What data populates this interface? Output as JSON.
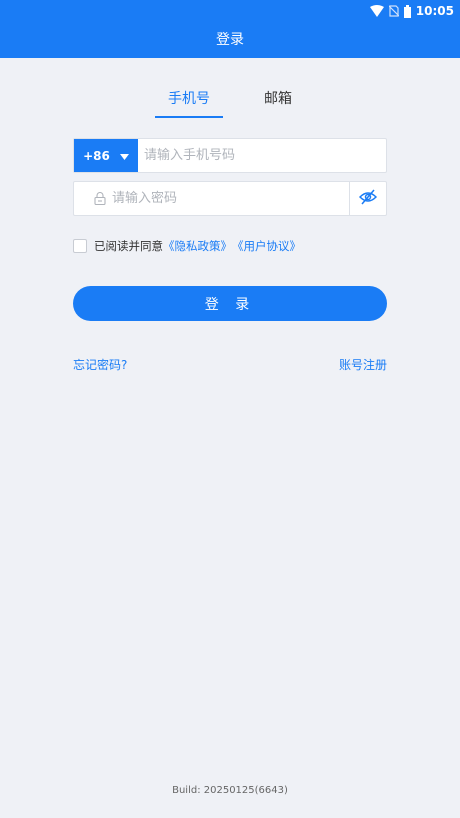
{
  "status_bar": {
    "time": "10:05",
    "icons": [
      "wifi-icon",
      "no-sim-icon",
      "battery-icon"
    ]
  },
  "header": {
    "title": "登录"
  },
  "tabs": [
    {
      "label": "手机号",
      "active": true
    },
    {
      "label": "邮箱",
      "active": false
    }
  ],
  "phone": {
    "country_code": "+86",
    "placeholder": "请输入手机号码",
    "value": ""
  },
  "password": {
    "placeholder": "请输入密码",
    "value": ""
  },
  "agreement": {
    "prefix": "已阅读并同意",
    "privacy_link": "《隐私政策》",
    "terms_link": "《用户协议》",
    "checked": false
  },
  "login_button": "登 录",
  "forgot_link": "忘记密码?",
  "register_link": "账号注册",
  "build": "Build: 20250125(6643)",
  "colors": {
    "accent": "#1a7cf5",
    "background": "#eff1f6"
  }
}
